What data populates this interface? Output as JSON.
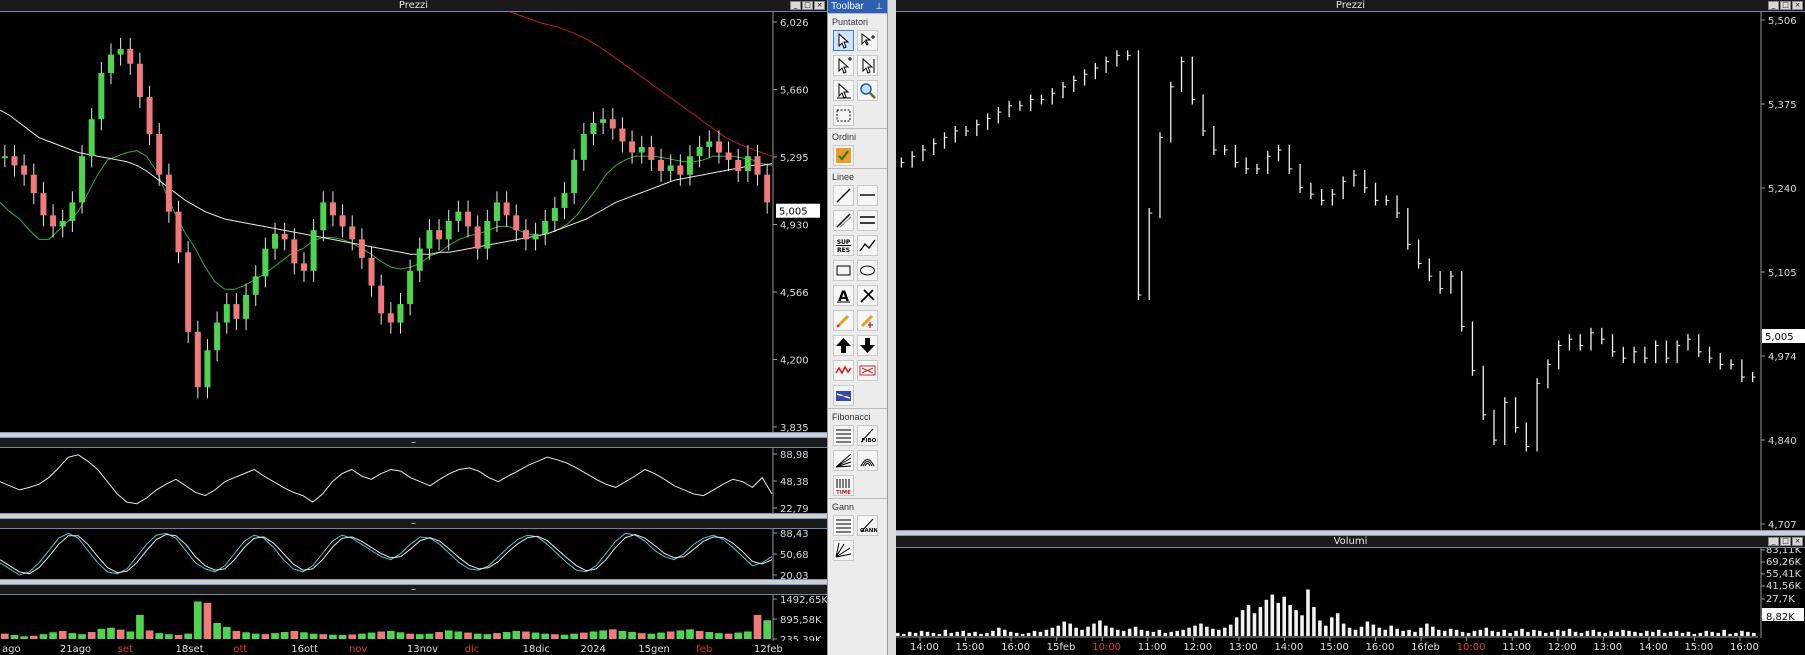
{
  "left_chart": {
    "title": "Prezzi",
    "price_ticks": [
      "6,026",
      "5,660",
      "5,295",
      "4,930",
      "4,566",
      "4,200",
      "3,835"
    ],
    "last_price": "5,005",
    "rsi_ticks": [
      "88,98",
      "48,38",
      "22,79"
    ],
    "stoch_ticks": [
      "88,43",
      "50,68",
      "20,03"
    ],
    "volume_ticks": [
      "1492,65K",
      "895,58K",
      "235,39K"
    ],
    "x_labels": [
      {
        "t": "ago",
        "red": false
      },
      {
        "t": "21ago",
        "red": false
      },
      {
        "t": "set",
        "red": true
      },
      {
        "t": "18set",
        "red": false
      },
      {
        "t": "ott",
        "red": true
      },
      {
        "t": "16ott",
        "red": false
      },
      {
        "t": "nov",
        "red": true
      },
      {
        "t": "13nov",
        "red": false
      },
      {
        "t": "dic",
        "red": true
      },
      {
        "t": "18dic",
        "red": false
      },
      {
        "t": "2024",
        "red": false
      },
      {
        "t": "15gen",
        "red": false
      },
      {
        "t": "feb",
        "red": true
      },
      {
        "t": "12feb",
        "red": false
      }
    ],
    "subpanel_title": "–"
  },
  "toolbar": {
    "title": "Toolbar",
    "sections": [
      {
        "label": "Puntatori",
        "rows": [
          [
            "cursor-icon",
            "cursor-crosshair-icon"
          ],
          [
            "cursor-plus-icon",
            "cursor-line-icon"
          ],
          [
            "cursor-move-icon",
            "zoom-icon"
          ],
          [
            "select-area-icon"
          ]
        ]
      },
      {
        "label": "Ordini",
        "rows": [
          [
            "order-icon"
          ]
        ]
      },
      {
        "label": "Linee",
        "rows": [
          [
            "trendline-icon",
            "horizontal-line-icon"
          ],
          [
            "diagonal-line-icon",
            "channel-icon"
          ],
          [
            "support-resistance-icon",
            "polyline-icon"
          ],
          [
            "rectangle-icon",
            "ellipse-icon"
          ],
          [
            "text-icon",
            "pen-icon"
          ],
          [
            "pencil-icon",
            "eraser-icon"
          ],
          [
            "arrow-up-icon",
            "arrow-down-icon"
          ],
          [
            "wave-icon",
            "alert-icon"
          ],
          [
            "flag-icon"
          ]
        ]
      },
      {
        "label": "Fibonacci",
        "rows": [
          [
            "fibo-retracement-icon",
            "fibo-label-icon"
          ],
          [
            "fibo-fan-icon",
            "fibo-arc-icon"
          ],
          [
            "fibo-time-icon"
          ]
        ]
      },
      {
        "label": "Gann",
        "rows": [
          [
            "gann-levels-icon",
            "gann-box-icon"
          ],
          [
            "gann-fan-icon"
          ]
        ]
      }
    ]
  },
  "right_chart": {
    "title": "Prezzi",
    "price_ticks": [
      "5,506",
      "5,375",
      "5,240",
      "5,105",
      "4,974",
      "4,840",
      "4,707"
    ],
    "last_price": "5,005",
    "volume_title": "Volumi",
    "volume_ticks": [
      "83,11K",
      "69,26K",
      "55,41K",
      "41,56K",
      "27,7K",
      "8,82K"
    ],
    "x_labels": [
      {
        "t": "14:00",
        "red": false
      },
      {
        "t": "15:00",
        "red": false
      },
      {
        "t": "16:00",
        "red": false
      },
      {
        "t": "15feb",
        "red": false
      },
      {
        "t": "10:00",
        "red": true
      },
      {
        "t": "11:00",
        "red": false
      },
      {
        "t": "12:00",
        "red": false
      },
      {
        "t": "13:00",
        "red": false
      },
      {
        "t": "14:00",
        "red": false
      },
      {
        "t": "15:00",
        "red": false
      },
      {
        "t": "16:00",
        "red": false
      },
      {
        "t": "16feb",
        "red": false
      },
      {
        "t": "10:00",
        "red": true
      },
      {
        "t": "11:00",
        "red": false
      },
      {
        "t": "12:00",
        "red": false
      },
      {
        "t": "13:00",
        "red": false
      },
      {
        "t": "14:00",
        "red": false
      },
      {
        "t": "15:00",
        "red": false
      },
      {
        "t": "16:00",
        "red": false
      }
    ]
  },
  "chart_data": [
    {
      "type": "candlestick",
      "title": "Prezzi",
      "ylim": [
        3.835,
        6.026
      ],
      "x_ticks": [
        "ago",
        "21ago",
        "set",
        "18set",
        "ott",
        "16ott",
        "nov",
        "13nov",
        "dic",
        "18dic",
        "2024",
        "15gen",
        "feb",
        "12feb"
      ],
      "close": [
        5.3,
        5.25,
        5.2,
        5.1,
        4.98,
        4.92,
        4.95,
        5.05,
        5.3,
        5.5,
        5.75,
        5.85,
        5.88,
        5.8,
        5.62,
        5.42,
        5.2,
        5.0,
        4.78,
        4.35,
        4.05,
        4.25,
        4.4,
        4.5,
        4.42,
        4.55,
        4.65,
        4.8,
        4.88,
        4.85,
        4.72,
        4.68,
        4.9,
        5.05,
        4.98,
        4.92,
        4.85,
        4.75,
        4.6,
        4.45,
        4.4,
        4.5,
        4.68,
        4.8,
        4.9,
        4.85,
        4.95,
        5.0,
        4.92,
        4.8,
        4.95,
        5.05,
        4.98,
        4.9,
        4.85,
        4.88,
        4.95,
        5.02,
        5.1,
        5.28,
        5.42,
        5.48,
        5.5,
        5.45,
        5.38,
        5.32,
        5.35,
        5.28,
        5.22,
        5.25,
        5.2,
        5.3,
        5.35,
        5.38,
        5.32,
        5.28,
        5.22,
        5.3,
        5.2,
        5.05
      ],
      "series": [
        {
          "name": "",
          "values": [
            5.05,
            5.0,
            4.96,
            4.9,
            4.85,
            4.85,
            4.9,
            4.95,
            5.0,
            5.1,
            5.2,
            5.28,
            5.3,
            5.32,
            5.33,
            5.3,
            5.22,
            5.1,
            4.98,
            4.88,
            4.8,
            4.7,
            4.62,
            4.58,
            4.58,
            4.6,
            4.63,
            4.66,
            4.7,
            4.74,
            4.78,
            4.8,
            4.84,
            4.86,
            4.86,
            4.85,
            4.83,
            4.8,
            4.77,
            4.73,
            4.7,
            4.69,
            4.7,
            4.72,
            4.76,
            4.78,
            4.82,
            4.85,
            4.87,
            4.88,
            4.9,
            4.92,
            4.92,
            4.9,
            4.88,
            4.87,
            4.88,
            4.9,
            4.93,
            4.98,
            5.05,
            5.12,
            5.2,
            5.25,
            5.28,
            5.3,
            5.3,
            5.3,
            5.29,
            5.28,
            5.27,
            5.27,
            5.28,
            5.3,
            5.3,
            5.3,
            5.29,
            5.28,
            5.26,
            5.25
          ]
        },
        {
          "name": "",
          "values": [
            5.55,
            5.52,
            5.48,
            5.44,
            5.4,
            5.38,
            5.36,
            5.34,
            5.32,
            5.31,
            5.3,
            5.29,
            5.28,
            5.27,
            5.25,
            5.22,
            5.18,
            5.14,
            5.1,
            5.06,
            5.03,
            5.0,
            4.98,
            4.96,
            4.95,
            4.94,
            4.93,
            4.92,
            4.91,
            4.9,
            4.89,
            4.88,
            4.87,
            4.86,
            4.85,
            4.84,
            4.83,
            4.82,
            4.81,
            4.8,
            4.79,
            4.78,
            4.77,
            4.77,
            4.77,
            4.78,
            4.78,
            4.79,
            4.8,
            4.81,
            4.82,
            4.83,
            4.84,
            4.85,
            4.86,
            4.87,
            4.88,
            4.9,
            4.92,
            4.94,
            4.96,
            4.99,
            5.02,
            5.05,
            5.07,
            5.09,
            5.11,
            5.13,
            5.15,
            5.17,
            5.18,
            5.19,
            5.2,
            5.21,
            5.22,
            5.23,
            5.24,
            5.25,
            5.25,
            5.26
          ]
        },
        {
          "name": "",
          "values": [
            6.12,
            6.1,
            6.08,
            6.05,
            6.02,
            6.0,
            5.97,
            5.93,
            5.88,
            5.82,
            5.76,
            5.7,
            5.64,
            5.58,
            5.52,
            5.46,
            5.4,
            5.36,
            5.33,
            5.3
          ]
        }
      ]
    },
    {
      "type": "line",
      "title": "",
      "ylim": [
        4.707,
        5.506
      ],
      "y_ticks": [
        5.506,
        5.375,
        5.24,
        5.105,
        4.974,
        4.84,
        4.707
      ],
      "values": [
        5.28,
        5.29,
        5.3,
        5.31,
        5.32,
        5.33,
        5.33,
        5.34,
        5.35,
        5.36,
        5.37,
        5.37,
        5.38,
        5.38,
        5.39,
        5.4,
        5.41,
        5.42,
        5.43,
        5.44,
        5.45,
        5.45,
        5.07,
        5.2,
        5.32,
        5.4,
        5.44,
        5.38,
        5.33,
        5.3,
        5.3,
        5.28,
        5.27,
        5.27,
        5.29,
        5.3,
        5.27,
        5.24,
        5.23,
        5.22,
        5.23,
        5.25,
        5.26,
        5.24,
        5.22,
        5.22,
        5.2,
        5.15,
        5.12,
        5.1,
        5.08,
        5.1,
        5.02,
        4.95,
        4.88,
        4.84,
        4.9,
        4.86,
        4.83,
        4.93,
        4.96,
        4.99,
        5.0,
        4.99,
        5.01,
        5.0,
        4.98,
        4.97,
        4.98,
        4.97,
        4.99,
        4.97,
        4.99,
        5.0,
        4.98,
        4.97,
        4.96,
        4.96,
        4.94,
        4.94
      ]
    },
    {
      "type": "bar",
      "title": "Volumi",
      "ylim": [
        0,
        83.11
      ],
      "y_ticks": [
        83.11,
        69.26,
        55.41,
        41.56,
        27.7,
        8.82
      ],
      "values": [
        3,
        2,
        4,
        3,
        5,
        4,
        3,
        2,
        6,
        3,
        4,
        5,
        3,
        4,
        2,
        3,
        5,
        8,
        6,
        4,
        3,
        2,
        3,
        5,
        4,
        6,
        8,
        10,
        14,
        12,
        8,
        6,
        9,
        12,
        15,
        10,
        8,
        6,
        5,
        7,
        9,
        6,
        5,
        4,
        6,
        3,
        4,
        5,
        6,
        8,
        10,
        12,
        9,
        7,
        6,
        8,
        11,
        18,
        25,
        30,
        22,
        28,
        35,
        40,
        32,
        38,
        30,
        25,
        20,
        45,
        28,
        15,
        10,
        18,
        22,
        12,
        8,
        6,
        9,
        14,
        11,
        8,
        6,
        10,
        7,
        5,
        6,
        4,
        8,
        12,
        9,
        6,
        5,
        7,
        6,
        4,
        3,
        5,
        6,
        8,
        5,
        4,
        6,
        3,
        5,
        7,
        4,
        6,
        5,
        3,
        4,
        6,
        5,
        7,
        4,
        3,
        5,
        6,
        4,
        3,
        5,
        4,
        6,
        5,
        4,
        3,
        5,
        4,
        6,
        3,
        4,
        5,
        3,
        4,
        2,
        3,
        5,
        4,
        3,
        6,
        2,
        3,
        5,
        4,
        3
      ]
    },
    {
      "type": "line",
      "title": "",
      "ylim": [
        22.79,
        88.98
      ],
      "y_ticks": [
        88.98,
        48.38,
        22.79
      ],
      "values": [
        55,
        50,
        45,
        48,
        52,
        60,
        72,
        85,
        88,
        80,
        70,
        55,
        40,
        30,
        28,
        35,
        45,
        52,
        58,
        50,
        42,
        38,
        45,
        55,
        60,
        65,
        70,
        62,
        55,
        48,
        42,
        38,
        30,
        40,
        55,
        65,
        70,
        62,
        58,
        65,
        70,
        68,
        60,
        55,
        50,
        58,
        65,
        70,
        72,
        68,
        60,
        55,
        62,
        68,
        75,
        80,
        85,
        82,
        78,
        72,
        65,
        58,
        52,
        48,
        55,
        62,
        70,
        65,
        58,
        50,
        45,
        40,
        38,
        45,
        52,
        58,
        55,
        48,
        60,
        40
      ]
    },
    {
      "type": "line",
      "title": "",
      "ylim": [
        20.03,
        88.43
      ],
      "y_ticks": [
        88.43,
        50.68,
        20.03
      ],
      "series": [
        {
          "name": "",
          "values": [
            40,
            30,
            20,
            25,
            40,
            60,
            80,
            88,
            80,
            60,
            40,
            25,
            22,
            30,
            50,
            70,
            85,
            88,
            80,
            60,
            40,
            30,
            25,
            35,
            55,
            75,
            85,
            80,
            65,
            45,
            30,
            25,
            35,
            55,
            75,
            85,
            80,
            70,
            60,
            50,
            45,
            55,
            70,
            82,
            80,
            70,
            55,
            40,
            30,
            28,
            35,
            50,
            65,
            78,
            85,
            82,
            70,
            55,
            40,
            28,
            25,
            35,
            55,
            75,
            88,
            85,
            75,
            60,
            50,
            45,
            55,
            70,
            80,
            85,
            78,
            65,
            50,
            35,
            40,
            50
          ]
        },
        {
          "name": "",
          "values": [
            45,
            35,
            25,
            22,
            32,
            50,
            70,
            84,
            84,
            70,
            50,
            32,
            24,
            26,
            40,
            60,
            78,
            86,
            84,
            70,
            50,
            35,
            28,
            30,
            45,
            65,
            80,
            82,
            72,
            55,
            38,
            28,
            30,
            45,
            65,
            80,
            82,
            75,
            65,
            55,
            48,
            50,
            62,
            76,
            81,
            75,
            62,
            48,
            36,
            30,
            32,
            42,
            58,
            71,
            81,
            83,
            76,
            62,
            48,
            35,
            27,
            30,
            45,
            65,
            81,
            86,
            80,
            68,
            55,
            48,
            50,
            62,
            75,
            82,
            81,
            72,
            58,
            42,
            38,
            45
          ]
        }
      ]
    },
    {
      "type": "bar",
      "title": "",
      "ylim": [
        0,
        1492.65
      ],
      "y_ticks": [
        1492.65,
        895.58,
        235.39
      ],
      "values": [
        200,
        150,
        100,
        120,
        180,
        250,
        300,
        220,
        180,
        260,
        380,
        420,
        350,
        280,
        900,
        320,
        220,
        180,
        150,
        200,
        1400,
        1350,
        600,
        450,
        300,
        250,
        200,
        180,
        220,
        260,
        300,
        250,
        200,
        180,
        160,
        150,
        170,
        200,
        240,
        280,
        300,
        250,
        200,
        180,
        200,
        260,
        320,
        280,
        240,
        200,
        180,
        220,
        260,
        300,
        280,
        240,
        200,
        180,
        160,
        200,
        240,
        280,
        320,
        360,
        300,
        260,
        220,
        200,
        240,
        280,
        320,
        360,
        300,
        260,
        220,
        200,
        240,
        280,
        900,
        700
      ]
    }
  ]
}
